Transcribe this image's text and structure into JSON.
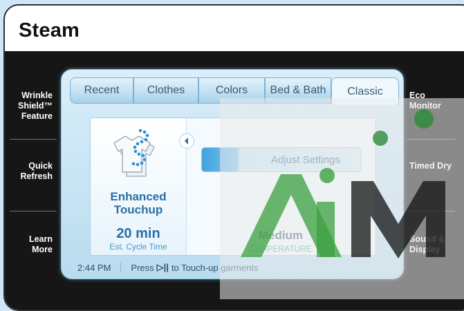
{
  "title": "Steam",
  "left_options": [
    {
      "label": "Wrinkle Shield™ Feature"
    },
    {
      "label": "Quick Refresh"
    },
    {
      "label": "Learn More"
    }
  ],
  "right_options": [
    {
      "label": "Eco Monitor"
    },
    {
      "label": "Timed Dry"
    },
    {
      "label": "Sound & Display"
    }
  ],
  "tabs": [
    {
      "label": "Recent"
    },
    {
      "label": "Clothes"
    },
    {
      "label": "Colors"
    },
    {
      "label": "Bed & Bath"
    },
    {
      "label": "Classic",
      "active": true
    }
  ],
  "program": {
    "name_line1": "Enhanced",
    "name_line2": "Touchup",
    "time": "20 min",
    "time_label": "Est. Cycle Time"
  },
  "adjust_button": "Adjust Settings",
  "temperature": {
    "value": "Medium",
    "label": "TEMPERATURE"
  },
  "status_bar": {
    "clock": "2:44 PM",
    "hint_prefix": "Press",
    "hint_icon": "▷||",
    "hint_suffix": "to Touch-up garments"
  },
  "colors": {
    "accent": "#2a6fa4",
    "temperature_label": "#3fb2a8",
    "screen_bg": "#161616"
  }
}
